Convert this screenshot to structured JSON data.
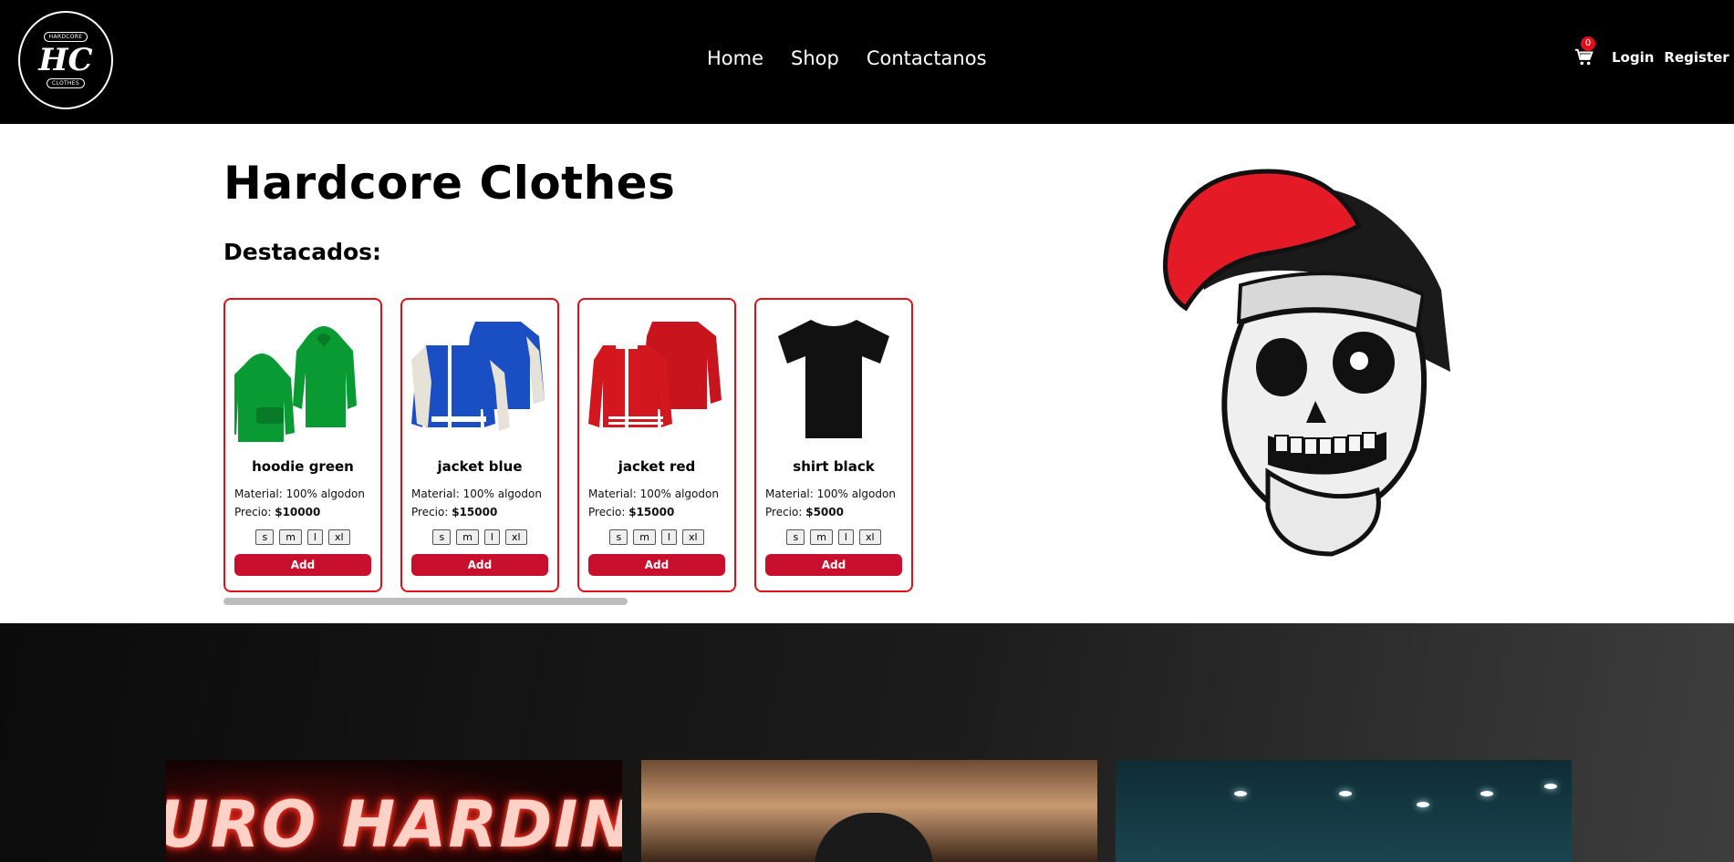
{
  "header": {
    "logo": {
      "top_text": "HARDCORE",
      "monogram": "HC",
      "bottom_text": "CLOTHES"
    },
    "nav": [
      {
        "label": "Home"
      },
      {
        "label": "Shop"
      },
      {
        "label": "Contactanos"
      }
    ],
    "cart_count": "0",
    "login_label": "Login",
    "register_label": "Register"
  },
  "hero": {
    "title": "Hardcore Clothes",
    "featured_label": "Destacados:"
  },
  "products": [
    {
      "name": "hoodie green",
      "material": "Material: 100% algodon",
      "price_label": "Precio:",
      "price": "$10000",
      "color": "#0a9a34",
      "icon": "hoodie-icon"
    },
    {
      "name": "jacket blue",
      "material": "Material: 100% algodon",
      "price_label": "Precio:",
      "price": "$15000",
      "color": "#1a4fc4",
      "icon": "jacket-icon"
    },
    {
      "name": "jacket red",
      "material": "Material: 100% algodon",
      "price_label": "Precio:",
      "price": "$15000",
      "color": "#c8141c",
      "icon": "jacket-icon"
    },
    {
      "name": "shirt black",
      "material": "Material: 100% algodon",
      "price_label": "Precio:",
      "price": "$5000",
      "color": "#111111",
      "icon": "tshirt-icon"
    }
  ],
  "sizes": [
    "s",
    "m",
    "l",
    "xl"
  ],
  "add_label": "Add",
  "colors": {
    "accent": "#c8102e",
    "header_bg": "#000000",
    "border": "#e0101a"
  }
}
